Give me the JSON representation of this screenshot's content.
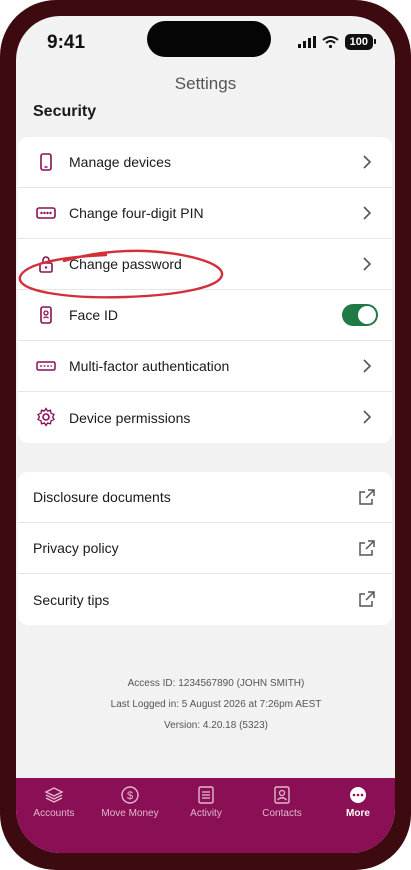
{
  "status_bar": {
    "time": "9:41",
    "battery": "100"
  },
  "header": {
    "title": "Settings"
  },
  "security": {
    "heading": "Security",
    "items": [
      {
        "label": "Manage devices",
        "icon": "phone-icon"
      },
      {
        "label": "Change four-digit PIN",
        "icon": "pin-icon"
      },
      {
        "label": "Change password",
        "icon": "lock-icon"
      },
      {
        "label": "Face ID",
        "icon": "face-id-icon",
        "toggle_on": true
      },
      {
        "label": "Multi-factor authentication",
        "icon": "mfa-icon"
      },
      {
        "label": "Device permissions",
        "icon": "gear-icon"
      }
    ]
  },
  "links": [
    {
      "label": "Disclosure documents"
    },
    {
      "label": "Privacy policy"
    },
    {
      "label": "Security tips"
    }
  ],
  "footer": {
    "access_id": "Access ID: 1234567890 (JOHN SMITH)",
    "last_logged": "Last Logged in: 5 August 2026 at 7:26pm AEST",
    "version": "Version: 4.20.18 (5323)"
  },
  "tabs": [
    {
      "label": "Accounts",
      "icon": "layers-icon"
    },
    {
      "label": "Move Money",
      "icon": "dollar-icon"
    },
    {
      "label": "Activity",
      "icon": "list-icon"
    },
    {
      "label": "Contacts",
      "icon": "contact-icon"
    },
    {
      "label": "More",
      "icon": "more-icon",
      "active": true
    }
  ],
  "colors": {
    "brand": "#8a0f55",
    "toggle_on": "#1f7a46",
    "annotation": "#d32f3a"
  }
}
